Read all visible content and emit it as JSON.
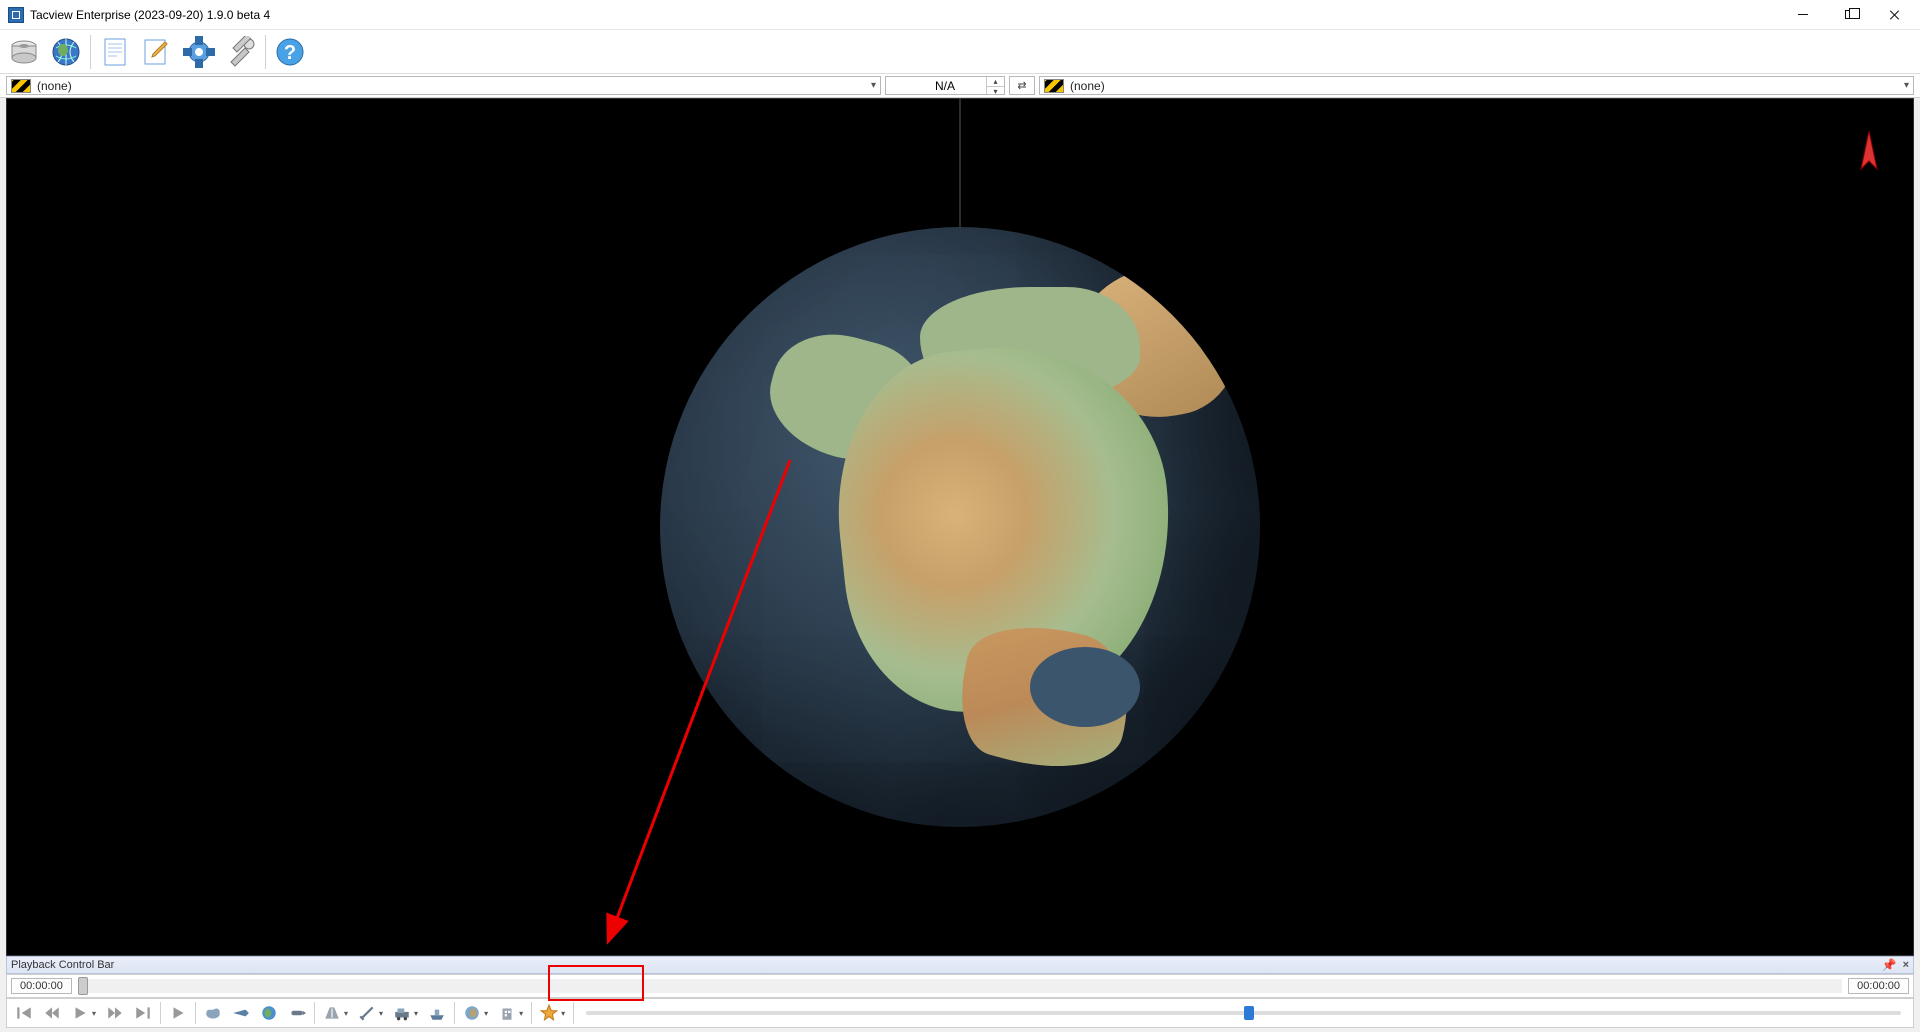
{
  "titlebar": {
    "title": "Tacview Enterprise (2023-09-20) 1.9.0 beta 4"
  },
  "selectors": {
    "left_label": "(none)",
    "center_label": "N/A",
    "right_label": "(none)"
  },
  "playback": {
    "title": "Playback Control Bar",
    "time_left": "00:00:00",
    "time_right": "00:00:00"
  },
  "toolbar_main": {
    "open_local": "Open",
    "open_online": "Online",
    "report": "Report",
    "edit": "Edit",
    "settings": "Settings",
    "tools": "Tools",
    "help": "Help"
  }
}
